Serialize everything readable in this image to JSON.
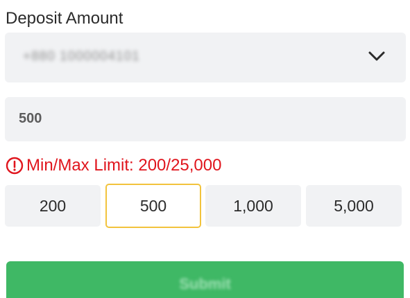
{
  "form": {
    "title": "Deposit Amount",
    "account_select": {
      "value": "+880 1000004101",
      "icon": "chevron-down-icon"
    },
    "amount_input": {
      "value": "500"
    },
    "limit_notice": {
      "icon": "alert-circle-icon",
      "text": "Min/Max Limit: 200/25,000",
      "color": "#e0151d"
    },
    "quick_amounts": [
      {
        "label": "200",
        "selected": false
      },
      {
        "label": "500",
        "selected": true
      },
      {
        "label": "1,000",
        "selected": false
      },
      {
        "label": "5,000",
        "selected": false
      }
    ],
    "submit": {
      "label": "Submit",
      "color": "#3fb865"
    },
    "colors": {
      "field_bg": "#f1f2f4",
      "selected_border": "#f2c33c"
    }
  }
}
